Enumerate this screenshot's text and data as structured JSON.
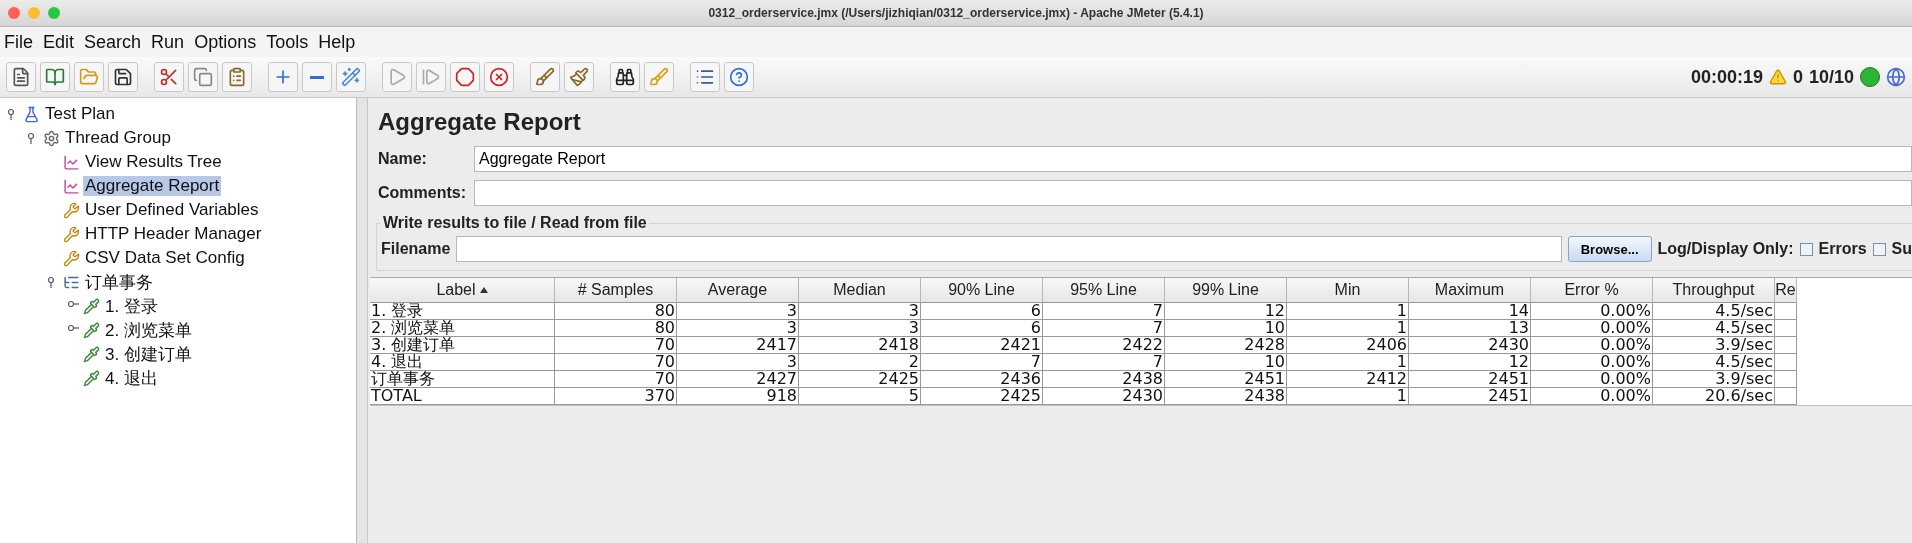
{
  "window": {
    "title": "0312_orderservice.jmx (/Users/jizhiqian/0312_orderservice.jmx) - Apache JMeter (5.4.1)"
  },
  "menu": [
    "File",
    "Edit",
    "Search",
    "Run",
    "Options",
    "Tools",
    "Help"
  ],
  "status": {
    "time": "00:00:19",
    "warnings": "0",
    "threads": "10/10",
    "running": true
  },
  "tree": [
    {
      "label": "Test Plan",
      "kind": "plan",
      "selected": false,
      "expanded": true,
      "children": [
        {
          "label": "Thread Group",
          "kind": "thread-group",
          "selected": false,
          "expanded": true,
          "children": [
            {
              "label": "View Results Tree",
              "kind": "listener",
              "selected": false
            },
            {
              "label": "Aggregate Report",
              "kind": "listener",
              "selected": true
            },
            {
              "label": "User Defined Variables",
              "kind": "config",
              "selected": false
            },
            {
              "label": "HTTP Header Manager",
              "kind": "config",
              "selected": false
            },
            {
              "label": "CSV Data Set Config",
              "kind": "config",
              "selected": false
            },
            {
              "label": "订单事务",
              "kind": "transaction",
              "selected": false,
              "expanded": true,
              "children": [
                {
                  "label": "1. 登录",
                  "kind": "sampler",
                  "selected": false,
                  "expanded": false
                },
                {
                  "label": "2. 浏览菜单",
                  "kind": "sampler",
                  "selected": false,
                  "expanded": false
                },
                {
                  "label": "3. 创建订单",
                  "kind": "sampler",
                  "selected": false
                },
                {
                  "label": "4. 退出",
                  "kind": "sampler",
                  "selected": false
                }
              ]
            }
          ]
        }
      ]
    }
  ],
  "panel": {
    "title": "Aggregate Report",
    "name_label": "Name:",
    "name_value": "Aggregate Report",
    "comments_label": "Comments:",
    "file_group": {
      "title": "Write results to file / Read from file",
      "filename_label": "Filename",
      "browse": "Browse...",
      "log_label": "Log/Display Only:",
      "options": [
        {
          "label": "Errors",
          "checked": false
        },
        {
          "label": "Su",
          "checked": false
        }
      ]
    }
  },
  "table": {
    "columns": [
      {
        "label": "Label",
        "sorted": true
      },
      {
        "label": "# Samples",
        "sorted": false
      },
      {
        "label": "Average",
        "sorted": false
      },
      {
        "label": "Median",
        "sorted": false
      },
      {
        "label": "90% Line",
        "sorted": false
      },
      {
        "label": "95% Line",
        "sorted": false
      },
      {
        "label": "99% Line",
        "sorted": false
      },
      {
        "label": "Min",
        "sorted": false
      },
      {
        "label": "Maximum",
        "sorted": false
      },
      {
        "label": "Error %",
        "sorted": false
      },
      {
        "label": "Throughput",
        "sorted": false
      },
      {
        "label": "Re",
        "sorted": false
      }
    ],
    "rows": [
      [
        "1. 登录",
        "80",
        "3",
        "3",
        "6",
        "7",
        "12",
        "1",
        "14",
        "0.00%",
        "4.5/sec"
      ],
      [
        "2. 浏览菜单",
        "80",
        "3",
        "3",
        "6",
        "7",
        "10",
        "1",
        "13",
        "0.00%",
        "4.5/sec"
      ],
      [
        "3. 创建订单",
        "70",
        "2417",
        "2418",
        "2421",
        "2422",
        "2428",
        "2406",
        "2430",
        "0.00%",
        "3.9/sec"
      ],
      [
        "4. 退出",
        "70",
        "3",
        "2",
        "7",
        "7",
        "10",
        "1",
        "12",
        "0.00%",
        "4.5/sec"
      ],
      [
        "订单事务",
        "70",
        "2427",
        "2425",
        "2436",
        "2438",
        "2451",
        "2412",
        "2451",
        "0.00%",
        "3.9/sec"
      ],
      [
        "TOTAL",
        "370",
        "918",
        "5",
        "2425",
        "2430",
        "2438",
        "1",
        "2451",
        "0.00%",
        "20.6/sec"
      ]
    ]
  }
}
